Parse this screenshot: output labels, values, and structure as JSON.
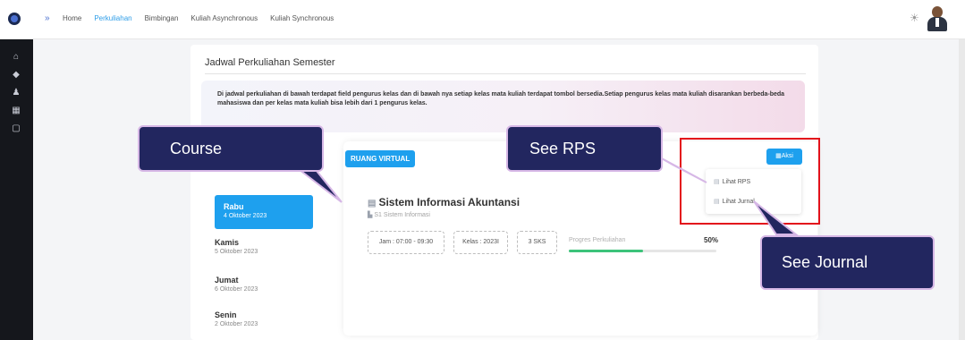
{
  "nav": {
    "items": [
      "Home",
      "Perkuliahan",
      "Bimbingan",
      "Kuliah Asynchronous",
      "Kuliah Synchronous"
    ],
    "active_index": 1
  },
  "page": {
    "title": "Jadwal Perkuliahan Semester",
    "info_text": "Di jadwal perkuliahan di bawah terdapat field pengurus kelas dan di bawah nya setiap kelas mata kuliah terdapat tombol bersedia.Setiap pengurus kelas mata kuliah disarankan berbeda-beda mahasiswa dan per kelas mata kuliah bisa lebih dari 1 pengurus kelas."
  },
  "days": [
    {
      "day": "Rabu",
      "date": "4 Oktober 2023",
      "active": true
    },
    {
      "day": "Kamis",
      "date": "5 Oktober 2023",
      "active": false
    },
    {
      "day": "Jumat",
      "date": "6 Oktober 2023",
      "active": false
    },
    {
      "day": "Senin",
      "date": "2 Oktober 2023",
      "active": false
    }
  ],
  "room": {
    "label": "RUANG VIRTUAL",
    "course_title": "Sistem Informasi Akuntansi",
    "course_program": "S1 Sistem Informasi",
    "time": "Jam : 07:00 - 09:30",
    "class": "Kelas : 2023I",
    "credits": "3 SKS",
    "progress_label": "Progres Perkuliahan",
    "progress_pct_text": "50%",
    "progress_value": 50
  },
  "actions": {
    "aksi_label": "Aksi",
    "menu": [
      "Lihat RPS",
      "Lihat Jurnal"
    ]
  },
  "callouts": {
    "course": "Course",
    "rps": "See RPS",
    "journal": "See Journal"
  },
  "colors": {
    "accent": "#1ea0ee",
    "sidebar": "#15171c",
    "callout": "#22265f",
    "highlight": "#e3121b",
    "progress": "#3cc37a"
  }
}
